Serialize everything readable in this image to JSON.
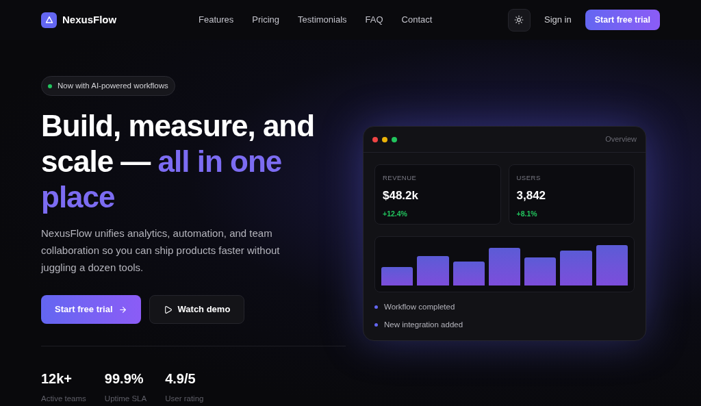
{
  "brand": {
    "name": "NexusFlow"
  },
  "nav": {
    "links": [
      "Features",
      "Pricing",
      "Testimonials",
      "FAQ",
      "Contact"
    ],
    "sign_in": "Sign in",
    "cta": "Start free trial"
  },
  "hero": {
    "badge": "Now with AI-powered workflows",
    "headline": "Build, measure, and scale — ",
    "headline_accent": "all in one place",
    "description": "NexusFlow unifies analytics, automation, and team collaboration so you can ship products faster without juggling a dozen tools.",
    "primary_button": "Start free trial",
    "secondary_button": "Watch demo",
    "stats": [
      {
        "value": "12k+",
        "label": "Active teams"
      },
      {
        "value": "99.9%",
        "label": "Uptime SLA"
      },
      {
        "value": "4.9/5",
        "label": "User rating"
      }
    ]
  },
  "preview": {
    "title": "Overview",
    "metrics": [
      {
        "label": "REVENUE",
        "value": "$48.2k",
        "change": "+12.4%"
      },
      {
        "label": "USERS",
        "value": "3,842",
        "change": "+8.1%"
      }
    ],
    "activity": [
      "Workflow completed",
      "New integration added"
    ]
  }
}
